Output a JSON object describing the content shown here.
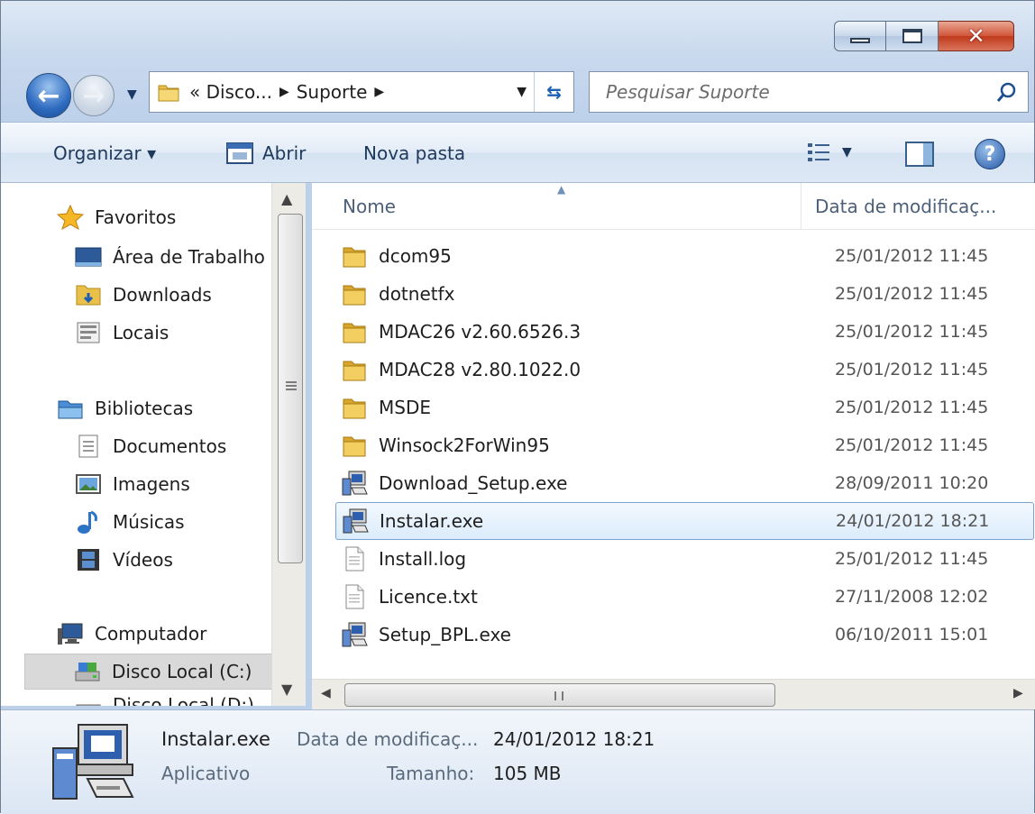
{
  "address": {
    "crumbs": [
      "« Disco...",
      "Suporte"
    ]
  },
  "search": {
    "placeholder": "Pesquisar Suporte"
  },
  "toolbar": {
    "organize": "Organizar ▾",
    "open": "Abrir",
    "new_folder": "Nova pasta"
  },
  "navpane": {
    "items": [
      {
        "label": "Favoritos",
        "icon": "star-icon"
      },
      {
        "label": "Área de Trabalho",
        "icon": "desktop-icon"
      },
      {
        "label": "Downloads",
        "icon": "downloads-folder-icon"
      },
      {
        "label": "Locais",
        "icon": "recent-places-icon"
      },
      {
        "label": "Bibliotecas",
        "icon": "libraries-icon"
      },
      {
        "label": "Documentos",
        "icon": "documents-icon"
      },
      {
        "label": "Imagens",
        "icon": "pictures-icon"
      },
      {
        "label": "Músicas",
        "icon": "music-icon"
      },
      {
        "label": "Vídeos",
        "icon": "videos-icon"
      },
      {
        "label": "Computador",
        "icon": "computer-icon"
      },
      {
        "label": "Disco Local (C:)",
        "icon": "local-disk-icon"
      },
      {
        "label": "Disco Local (D:)",
        "icon": "local-disk-icon"
      }
    ]
  },
  "columns": {
    "name": "Nome",
    "date": "Data de modificaç..."
  },
  "files": [
    {
      "name": "dcom95",
      "date": "25/01/2012 11:45",
      "icon": "folder-icon"
    },
    {
      "name": "dotnetfx",
      "date": "25/01/2012 11:45",
      "icon": "folder-icon"
    },
    {
      "name": "MDAC26 v2.60.6526.3",
      "date": "25/01/2012 11:45",
      "icon": "folder-icon"
    },
    {
      "name": "MDAC28 v2.80.1022.0",
      "date": "25/01/2012 11:45",
      "icon": "folder-icon"
    },
    {
      "name": "MSDE",
      "date": "25/01/2012 11:45",
      "icon": "folder-icon"
    },
    {
      "name": "Winsock2ForWin95",
      "date": "25/01/2012 11:45",
      "icon": "folder-icon"
    },
    {
      "name": "Download_Setup.exe",
      "date": "28/09/2011 10:20",
      "icon": "installer-icon"
    },
    {
      "name": "Instalar.exe",
      "date": "24/01/2012 18:21",
      "icon": "installer-icon"
    },
    {
      "name": "Install.log",
      "date": "25/01/2012 11:45",
      "icon": "text-file-icon"
    },
    {
      "name": "Licence.txt",
      "date": "27/11/2008 12:02",
      "icon": "text-file-icon"
    },
    {
      "name": "Setup_BPL.exe",
      "date": "06/10/2011 15:01",
      "icon": "installer-icon"
    }
  ],
  "selected_file": "Instalar.exe",
  "details": {
    "name": "Instalar.exe",
    "type": "Aplicativo",
    "date_label": "Data de modificaç...",
    "date_value": "24/01/2012 18:21",
    "size_label": "Tamanho:",
    "size_value": "105 MB"
  },
  "colors": {
    "selection": "#dcecfc",
    "selection_border": "#7da2ce",
    "close_button": "#c0391c",
    "toolbar_text": "#1e395b"
  }
}
